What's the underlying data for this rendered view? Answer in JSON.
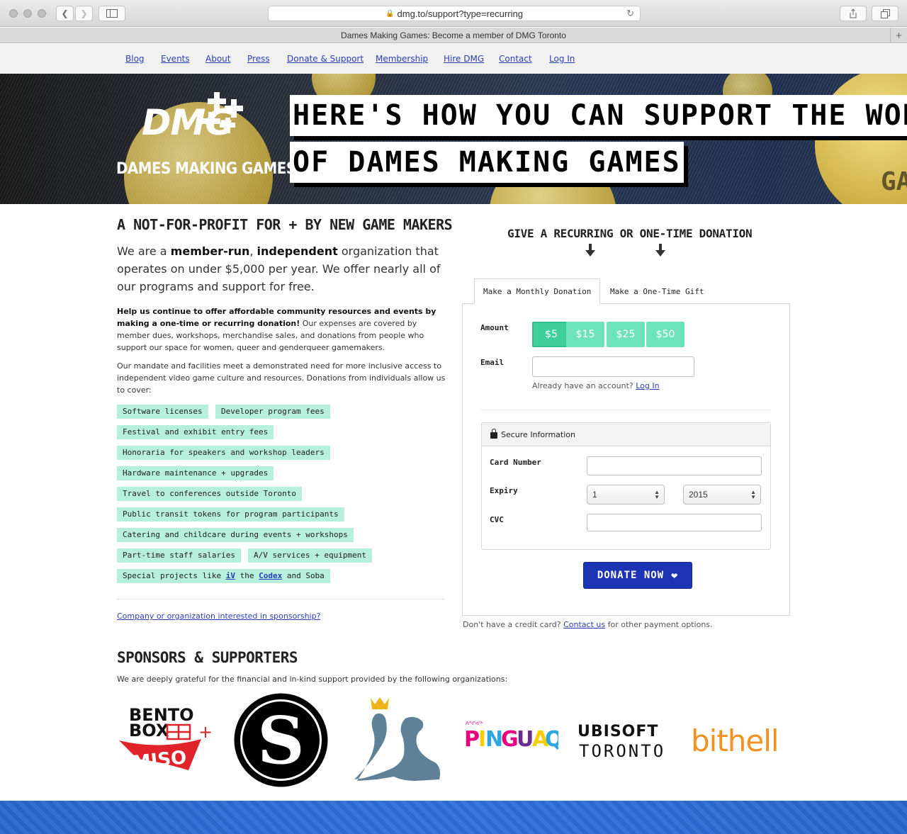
{
  "browser": {
    "url": "dmg.to/support?type=recurring",
    "tab_title": "Dames Making Games: Become a member of DMG Toronto"
  },
  "nav": {
    "items": [
      "Blog",
      "Events",
      "About",
      "Press",
      "Donate & Support",
      "Membership",
      "Hire DMG",
      "Contact",
      "Log In"
    ]
  },
  "hero": {
    "logo_mark": "DMG",
    "logo_name": "DAMES MAKING GAMES",
    "headline_line1": "HERE'S HOW YOU CAN SUPPORT THE WORK",
    "headline_line2": "OF DAMES MAKING GAMES"
  },
  "left": {
    "heading": "A NOT-FOR-PROFIT FOR + BY NEW GAME MAKERS",
    "lead_1": "We are a ",
    "lead_b1": "member-run",
    "lead_2": ", ",
    "lead_b2": "independent",
    "lead_3": " organization that operates on under $5,000 per year. We offer nearly all of our programs and support for free.",
    "para1_bold": "Help us continue to offer affordable community resources and events by making a one-time or recurring donation!",
    "para1_rest": " Our expenses are covered by member dues, workshops, merchandise sales, and donations from people who support our space for women, queer and genderqueer gamemakers.",
    "para2": "Our mandate and facilities meet a demonstrated need for more inclusive access to independent video game culture and resources. Donations from individuals allow us to cover:",
    "tags": [
      "Software licenses",
      "Developer program fees",
      "Festival and exhibit entry fees",
      "Honoraria for speakers and workshop leaders",
      "Hardware maintenance + upgrades",
      "Travel to conferences outside Toronto",
      "Public transit tokens for program participants",
      "Catering and childcare during events + workshops",
      "Part-time staff salaries",
      "A/V services + equipment"
    ],
    "special": {
      "prefix": "Special projects like ",
      "link1": "iV",
      "mid": " the ",
      "link2": "Codex",
      "suffix": " and Soba"
    },
    "sponsorship_link": "Company or organization interested in sponsorship?"
  },
  "form": {
    "heading": "GIVE A RECURRING OR ONE-TIME DONATION",
    "tab_monthly": "Make a Monthly Donation",
    "tab_onetime": "Make a One-Time Gift",
    "amount_label": "Amount",
    "amounts": [
      "$5",
      "$15",
      "$25",
      "$50"
    ],
    "selected_amount": "$5",
    "email_label": "Email",
    "email_value": "",
    "account_note": "Already have an account? ",
    "login_link": "Log In",
    "secure_title": "Secure Information",
    "card_label": "Card Number",
    "card_value": "",
    "expiry_label": "Expiry",
    "expiry_month": "1",
    "expiry_year": "2015",
    "cvc_label": "CVC",
    "cvc_value": "",
    "donate_button": "DONATE NOW",
    "no_card_note": "Don't have a credit card? ",
    "contact_link": "Contact us",
    "no_card_suffix": " for other payment options."
  },
  "sponsors": {
    "heading": "SPONSORS & SUPPORTERS",
    "intro": "We are deeply grateful for the financial and in-kind support provided by the following organizations:",
    "logos": [
      "BENTO BOX + MISO",
      "S",
      "",
      "PINGUAQ",
      "UBISOFT TORONTO",
      "bithell"
    ]
  },
  "colors": {
    "link": "#2a3fb6",
    "tag_bg": "#b6efdc",
    "amount_btn": "#6de3bb",
    "donate_btn": "#1c33b4",
    "footer": "#2f6fdb"
  }
}
